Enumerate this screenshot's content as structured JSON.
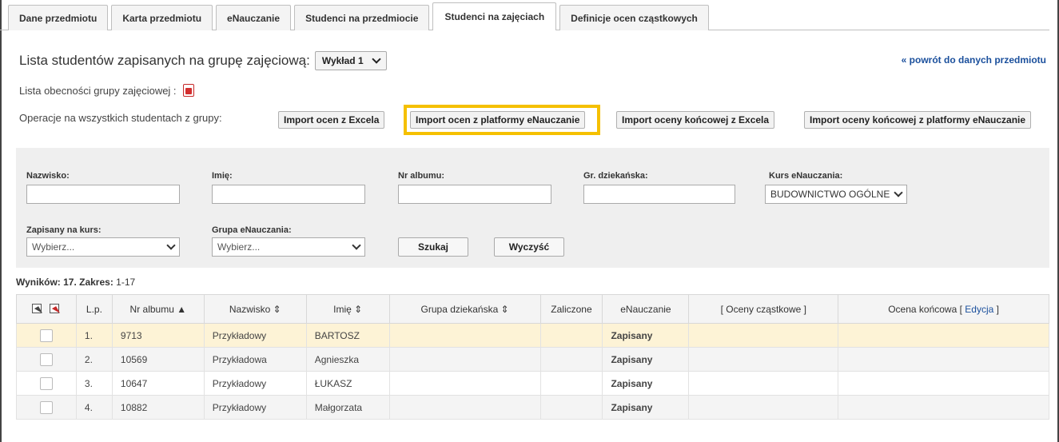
{
  "tabs": [
    {
      "label": "Dane przedmiotu",
      "active": false
    },
    {
      "label": "Karta przedmiotu",
      "active": false
    },
    {
      "label": "eNauczanie",
      "active": false
    },
    {
      "label": "Studenci na przedmiocie",
      "active": false
    },
    {
      "label": "Studenci na zajęciach",
      "active": true
    },
    {
      "label": "Definicje ocen cząstkowych",
      "active": false
    }
  ],
  "header": {
    "title": "Lista studentów zapisanych na grupę zajęciową:",
    "group_select_value": "Wykład 1",
    "back_link": "« powrót do danych przedmiotu",
    "attendance_label": "Lista obecności grupy zajęciowej :",
    "pdf_icon": "pdf-icon"
  },
  "operations": {
    "label": "Operacje na wszystkich studentach z grupy:",
    "buttons": [
      "Import ocen z Excela",
      "Import ocen z platformy eNauczanie",
      "Import oceny końcowej z Excela",
      "Import oceny końcowej z platformy eNauczanie"
    ],
    "highlight_color": "#f5c000"
  },
  "filters": {
    "nazwisko_label": "Nazwisko:",
    "imie_label": "Imię:",
    "nr_albumu_label": "Nr albumu:",
    "gr_dziekanska_label": "Gr. dziekańska:",
    "kurs_label": "Kurs eNauczania:",
    "kurs_value": "BUDOWNICTWO OGÓLNE",
    "zapisany_label": "Zapisany na kurs:",
    "zapisany_value": "Wybierz...",
    "grupa_label": "Grupa eNauczania:",
    "grupa_value": "Wybierz...",
    "search_button": "Szukaj",
    "clear_button": "Wyczyść"
  },
  "results": {
    "label": "Wyników: 17. Zakres:",
    "range": "1-17"
  },
  "table": {
    "headers": {
      "lp": "L.p.",
      "nr_albumu": "Nr albumu ▲",
      "nazwisko": "Nazwisko ⇕",
      "imie": "Imię ⇕",
      "grupa": "Grupa dziekańska ⇕",
      "zaliczone": "Zaliczone",
      "enauczanie": "eNauczanie",
      "oceny": "[ Oceny cząstkowe ]",
      "ocena_koncowa": "Ocena końcowa [",
      "edycja": "Edycja",
      "close_bracket": "]"
    },
    "rows": [
      {
        "lp": "1.",
        "nr": "9713",
        "nazwisko": "Przykładowy",
        "imie": "BARTOSZ",
        "grupa": "",
        "zaliczone": "",
        "enauczanie": "Zapisany",
        "oceny": "",
        "koncowa": ""
      },
      {
        "lp": "2.",
        "nr": "10569",
        "nazwisko": "Przykładowa",
        "imie": "Agnieszka",
        "grupa": "",
        "zaliczone": "",
        "enauczanie": "Zapisany",
        "oceny": "",
        "koncowa": ""
      },
      {
        "lp": "3.",
        "nr": "10647",
        "nazwisko": "Przykładowy",
        "imie": "ŁUKASZ",
        "grupa": "",
        "zaliczone": "",
        "enauczanie": "Zapisany",
        "oceny": "",
        "koncowa": ""
      },
      {
        "lp": "4.",
        "nr": "10882",
        "nazwisko": "Przykładowy",
        "imie": "Małgorzata",
        "grupa": "",
        "zaliczone": "",
        "enauczanie": "Zapisany",
        "oceny": "",
        "koncowa": ""
      }
    ]
  }
}
